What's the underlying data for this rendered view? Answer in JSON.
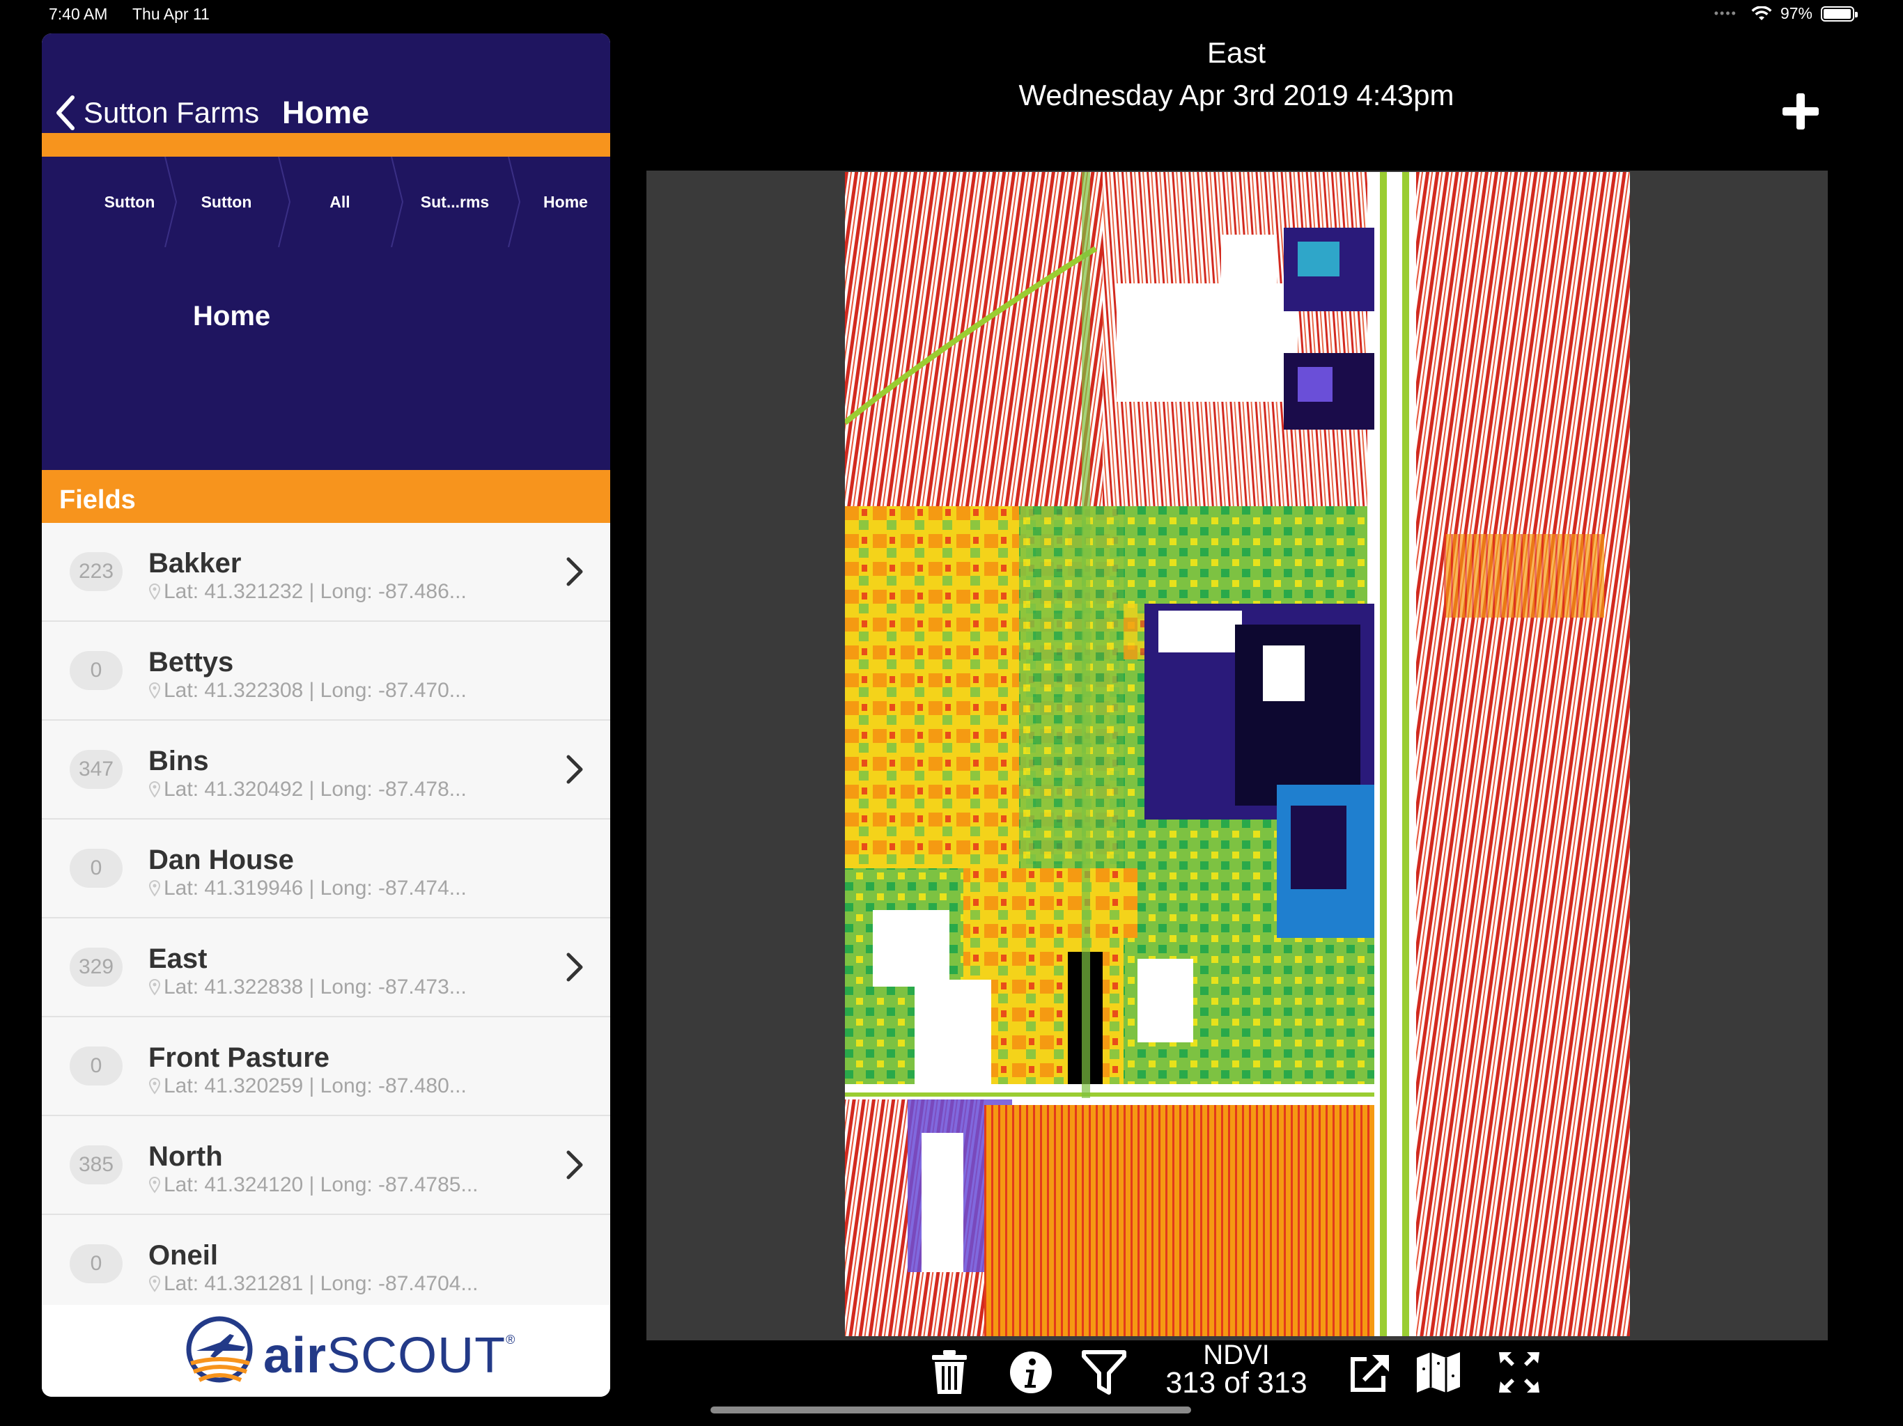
{
  "status_bar": {
    "time": "7:40 AM",
    "date": "Thu Apr 11",
    "battery": "97%",
    "battery_level": 0.97
  },
  "nav": {
    "back_label": "Sutton Farms",
    "title": "Home"
  },
  "breadcrumbs": [
    "Sutton",
    "Sutton",
    "All",
    "Sut...rms",
    "Home"
  ],
  "home_label": "Home",
  "fields_header": "Fields",
  "fields": [
    {
      "count": "223",
      "name": "Bakker",
      "coords": "Lat: 41.321232 | Long: -87.486...",
      "has_chevron": true
    },
    {
      "count": "0",
      "name": "Bettys",
      "coords": "Lat: 41.322308 | Long: -87.470...",
      "has_chevron": false
    },
    {
      "count": "347",
      "name": "Bins",
      "coords": "Lat: 41.320492 | Long: -87.478...",
      "has_chevron": true
    },
    {
      "count": "0",
      "name": "Dan House",
      "coords": "Lat: 41.319946 | Long: -87.474...",
      "has_chevron": false
    },
    {
      "count": "329",
      "name": "East",
      "coords": "Lat: 41.322838 | Long: -87.473...",
      "has_chevron": true
    },
    {
      "count": "0",
      "name": "Front Pasture",
      "coords": "Lat: 41.320259 | Long: -87.480...",
      "has_chevron": false
    },
    {
      "count": "385",
      "name": "North",
      "coords": "Lat: 41.324120 | Long: -87.4785...",
      "has_chevron": true
    },
    {
      "count": "0",
      "name": "Oneil",
      "coords": "Lat: 41.321281 | Long: -87.4704...",
      "has_chevron": false
    }
  ],
  "logo": {
    "text_a": "air",
    "text_b": "SCOUT",
    "mark": "®"
  },
  "viewer": {
    "field_name": "East",
    "datetime": "Wednesday Apr 3rd 2019 4:43pm",
    "layer": "NDVI",
    "position": "313 of 313"
  },
  "toolbar_icons": [
    "trash-icon",
    "info-icon",
    "filter-icon",
    "share-icon",
    "map-icon",
    "fullscreen-icon"
  ],
  "colors": {
    "nav_bg": "#1f1560",
    "accent_orange": "#f7941d",
    "list_bg": "#f7f7f7",
    "viewer_bg": "#3a3a3a",
    "brand_blue": "#233a88"
  }
}
